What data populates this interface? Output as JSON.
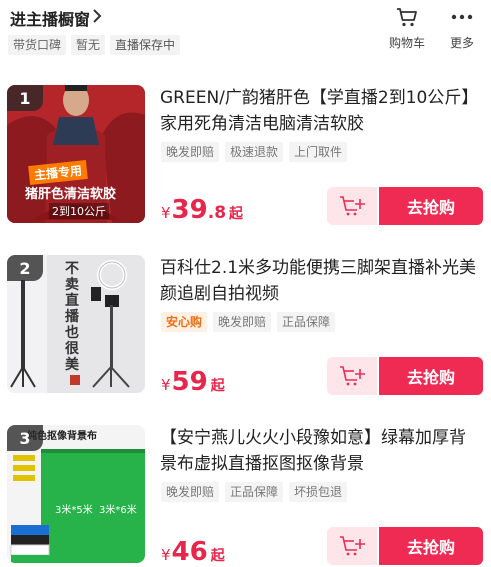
{
  "header": {
    "shop_title": "进主播橱窗",
    "tags": [
      "带货口碑",
      "暂无",
      "直播保存中"
    ],
    "cart_label": "购物车",
    "more_label": "更多"
  },
  "products": [
    {
      "rank": "1",
      "title": "GREEN/广韵猪肝色【学直播2到10公斤】家用死角清洁电脑清洁软胶",
      "badges": [
        "晚发即赔",
        "极速退款",
        "上门取件"
      ],
      "price_currency": "¥",
      "price_int": "39",
      "price_dec": ".8",
      "price_suffix": "起",
      "thumb_text": [
        "主播专用",
        "猪肝色清洁软胶",
        "2到10公斤"
      ],
      "buy_label": "去抢购"
    },
    {
      "rank": "2",
      "title": "百科仕2.1米多功能便携三脚架直播补光美颜追剧自拍视频",
      "safe_badge": "安心购",
      "badges": [
        "晚发即赔",
        "正品保障"
      ],
      "price_currency": "¥",
      "price_int": "59",
      "price_dec": "",
      "price_suffix": "起",
      "thumb_text": "不卖直播也很美",
      "buy_label": "去抢购"
    },
    {
      "rank": "3",
      "title": "【安宁燕儿火火小段豫如意】绿幕加厚背景布虚拟直播抠图抠像背景",
      "badges": [
        "晚发即赔",
        "正品保障",
        "坏损包退"
      ],
      "price_currency": "¥",
      "price_int": "46",
      "price_dec": "",
      "price_suffix": "起",
      "thumb_text": [
        "纯色抠像背景布",
        "3米*5米",
        "3米*6米"
      ],
      "buy_label": "去抢购"
    }
  ],
  "colors": {
    "accent": "#ef2b54",
    "price": "#e8254a",
    "safe_badge": "#e8711b"
  }
}
